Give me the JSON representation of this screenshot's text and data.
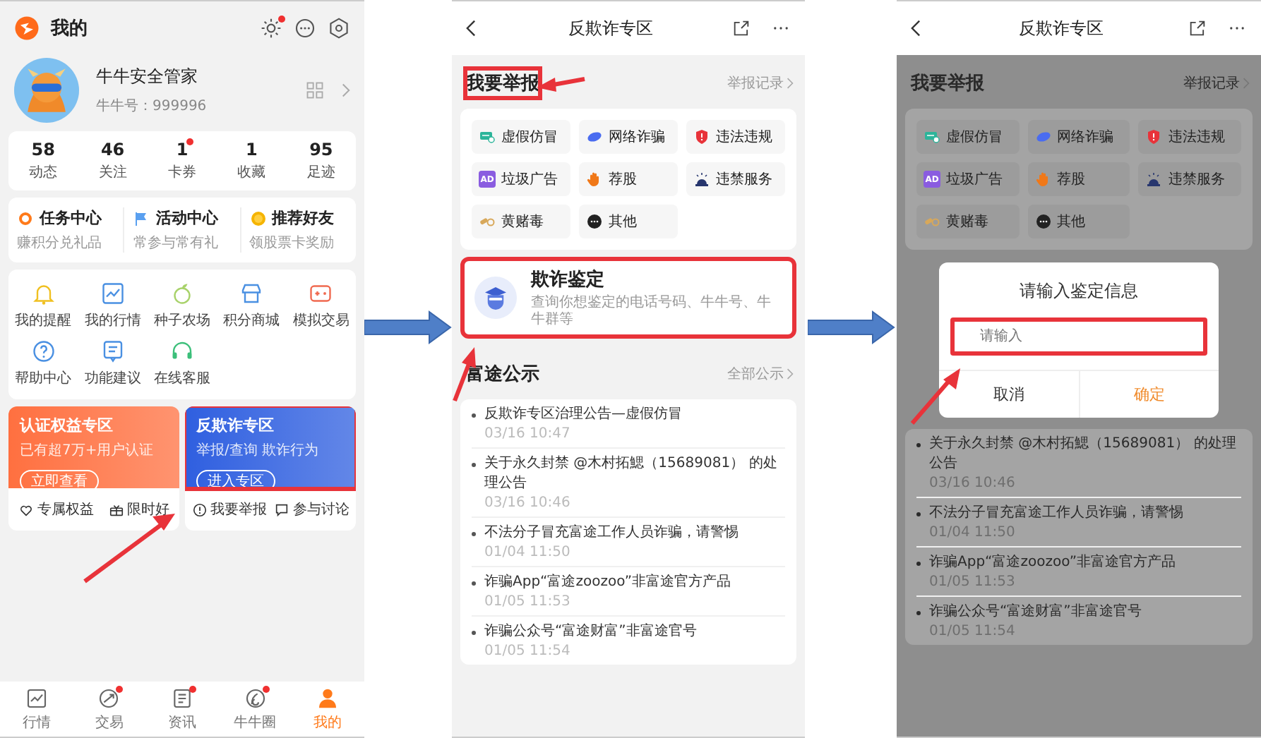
{
  "profile_screen": {
    "title": "我的",
    "header_icons": [
      {
        "kind": "sun",
        "badge": true
      },
      {
        "kind": "message",
        "badge": false
      },
      {
        "kind": "settings",
        "badge": false
      }
    ],
    "user": {
      "name": "牛牛安全管家",
      "id_label": "牛牛号：999996"
    },
    "stats": [
      {
        "value": "58",
        "label": "动态",
        "badge": false
      },
      {
        "value": "46",
        "label": "关注",
        "badge": false
      },
      {
        "value": "1",
        "label": "卡券",
        "badge": true
      },
      {
        "value": "1",
        "label": "收藏",
        "badge": false
      },
      {
        "value": "95",
        "label": "足迹",
        "badge": false
      }
    ],
    "tasks": [
      {
        "title": "任务中心",
        "subtitle": "赚积分兑礼品",
        "kind": "ring"
      },
      {
        "title": "活动中心",
        "subtitle": "常参与常有礼",
        "kind": "flag"
      },
      {
        "title": "推荐好友",
        "subtitle": "领股票卡奖励",
        "kind": "coin"
      }
    ],
    "services": [
      {
        "label": "我的提醒",
        "kind": "bell"
      },
      {
        "label": "我的行情",
        "kind": "chart"
      },
      {
        "label": "种子农场",
        "kind": "seed"
      },
      {
        "label": "积分商城",
        "kind": "shop"
      },
      {
        "label": "模拟交易",
        "kind": "gamepad"
      },
      {
        "label": "帮助中心",
        "kind": "help"
      },
      {
        "label": "功能建议",
        "kind": "note"
      },
      {
        "label": "在线客服",
        "kind": "headset"
      }
    ],
    "promos": [
      {
        "title": "认证权益专区",
        "subtitle": "已有超7万+用户认证",
        "button": "立即查看",
        "color": "#ff7040",
        "highlighted": false,
        "links": [
          {
            "label": "专属权益",
            "kind": "heart"
          },
          {
            "label": "限时好",
            "kind": "gift"
          }
        ]
      },
      {
        "title": "反欺诈专区",
        "subtitle": "举报/查询 欺诈行为",
        "button": "进入专区",
        "color": "#2f5fe0",
        "highlighted": true,
        "links": [
          {
            "label": "我要举报",
            "kind": "info"
          },
          {
            "label": "参与讨论",
            "kind": "chat"
          }
        ]
      }
    ],
    "tabs": [
      {
        "label": "行情",
        "kind": "linechart",
        "badge": false,
        "selected": false
      },
      {
        "label": "交易",
        "kind": "trade",
        "badge": true,
        "selected": false
      },
      {
        "label": "资讯",
        "kind": "news",
        "badge": true,
        "selected": false
      },
      {
        "label": "牛牛圈",
        "kind": "circle",
        "badge": true,
        "selected": false
      },
      {
        "label": "我的",
        "kind": "user",
        "badge": false,
        "selected": true
      }
    ]
  },
  "zone_screen": {
    "title": "反欺诈专区",
    "report": {
      "title": "我要举报",
      "highlighted": true,
      "link": "举报记录",
      "categories": [
        {
          "label": "虚假仿冒",
          "kind": "fake"
        },
        {
          "label": "网络诈骗",
          "kind": "net"
        },
        {
          "label": "违法违规",
          "kind": "illegal"
        },
        {
          "label": "垃圾广告",
          "kind": "ad",
          "icon_text": "AD"
        },
        {
          "label": "荐股",
          "kind": "stock"
        },
        {
          "label": "违禁服务",
          "kind": "banned"
        },
        {
          "label": "黄赌毒",
          "kind": "vice"
        },
        {
          "label": "其他",
          "kind": "other"
        }
      ]
    },
    "check": {
      "title": "欺诈鉴定",
      "subtitle": "查询你想鉴定的电话号码、牛牛号、牛牛群等",
      "highlighted": true
    },
    "notices": {
      "title": "富途公示",
      "link": "全部公示",
      "items": [
        {
          "text": "反欺诈专区治理公告—虚假仿冒",
          "date": "03/16 10:47"
        },
        {
          "text": "关于永久封禁 @木村拓鰓（15689081） 的处理公告",
          "date": "03/16 10:46"
        },
        {
          "text": "不法分子冒充富途工作人员诈骗，请警惕",
          "date": "01/04 11:50"
        },
        {
          "text": "诈骗App“富途zoozoo”非富途官方产品",
          "date": "01/05 11:53"
        },
        {
          "text": "诈骗公众号“富途财富”非富途官号",
          "date": "01/05 11:54"
        }
      ]
    }
  },
  "dialog_screen": {
    "title": "反欺诈专区",
    "report": {
      "title": "我要举报",
      "highlighted": false,
      "link": "举报记录",
      "categories": [
        {
          "label": "虚假仿冒",
          "kind": "fake"
        },
        {
          "label": "网络诈骗",
          "kind": "net"
        },
        {
          "label": "违法违规",
          "kind": "illegal"
        },
        {
          "label": "垃圾广告",
          "kind": "ad",
          "icon_text": "AD"
        },
        {
          "label": "荐股",
          "kind": "stock"
        },
        {
          "label": "违禁服务",
          "kind": "banned"
        },
        {
          "label": "黄赌毒",
          "kind": "vice"
        },
        {
          "label": "其他",
          "kind": "other"
        }
      ]
    },
    "dialog": {
      "title": "请输入鉴定信息",
      "placeholder": "请输入",
      "highlighted": true,
      "buttons": [
        {
          "label": "取消",
          "kind": "cancel"
        },
        {
          "label": "确定",
          "kind": "confirm"
        }
      ]
    },
    "notices": [
      {
        "text": "关于永久封禁 @木村拓鰓（15689081） 的处理公告",
        "date": "03/16 10:46"
      },
      {
        "text": "不法分子冒充富途工作人员诈骗，请警惕",
        "date": "01/04 11:50"
      },
      {
        "text": "诈骗App“富途zoozoo”非富途官方产品",
        "date": "01/05 11:53"
      },
      {
        "text": "诈骗公众号“富途财富”非富途官号",
        "date": "01/05 11:54"
      }
    ]
  }
}
